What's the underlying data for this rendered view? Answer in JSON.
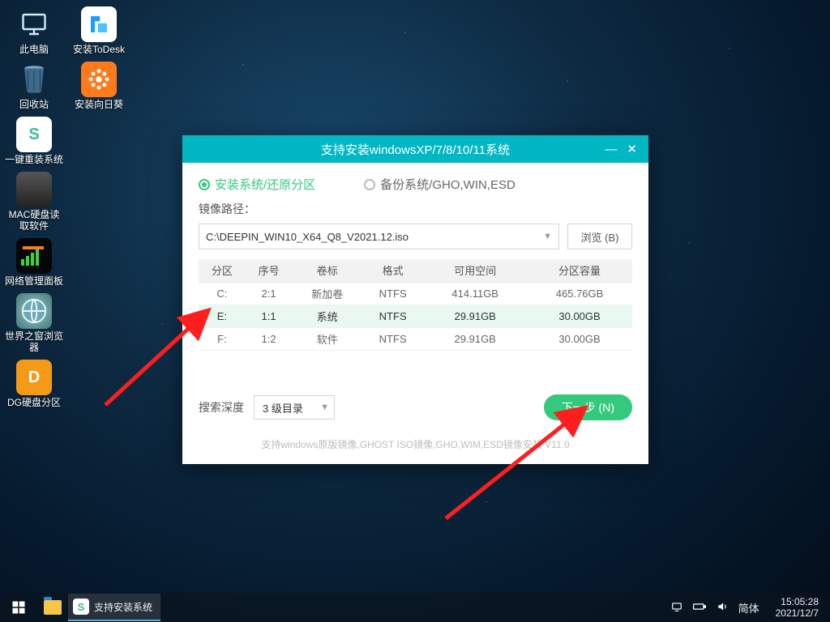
{
  "desktop": {
    "col1": [
      {
        "name": "pc",
        "label": "此电脑"
      },
      {
        "name": "bin",
        "label": "回收站"
      },
      {
        "name": "reinstall",
        "label": "一键重装系统"
      },
      {
        "name": "apple",
        "label": "MAC硬盘读\n取软件"
      },
      {
        "name": "netpanel",
        "label": "网络管理面板"
      },
      {
        "name": "browser",
        "label": "世界之窗浏览\n器"
      },
      {
        "name": "dg",
        "label": "DG硬盘分区"
      }
    ],
    "col2": [
      {
        "name": "todesk",
        "label": "安装ToDesk"
      },
      {
        "name": "sunflower",
        "label": "安装向日葵"
      }
    ]
  },
  "installer": {
    "title": "支持安装windowsXP/7/8/10/11系统",
    "tab_install": "安装系统/还原分区",
    "tab_backup": "备份系统/GHO,WIN,ESD",
    "path_label": "镜像路径：",
    "path_value": "C:\\DEEPIN_WIN10_X64_Q8_V2021.12.iso",
    "browse": "浏览 (B)",
    "columns": [
      "分区",
      "序号",
      "卷标",
      "格式",
      "可用空间",
      "分区容量"
    ],
    "rows": [
      {
        "part": "C:",
        "idx": "2:1",
        "label": "新加卷",
        "fs": "NTFS",
        "free": "414.11GB",
        "total": "465.76GB",
        "selected": false
      },
      {
        "part": "E:",
        "idx": "1:1",
        "label": "系统",
        "fs": "NTFS",
        "free": "29.91GB",
        "total": "30.00GB",
        "selected": true
      },
      {
        "part": "F:",
        "idx": "1:2",
        "label": "软件",
        "fs": "NTFS",
        "free": "29.91GB",
        "total": "30.00GB",
        "selected": false
      }
    ],
    "search_depth_label": "搜索深度",
    "search_depth_value": "3 级目录",
    "next": "下一步 (N)",
    "footer": "支持windows原版镜像,GHOST ISO镜像,GHO,WIM,ESD镜像安装 V11.0"
  },
  "taskbar": {
    "app_label": "支持安装系统",
    "ime": "简体",
    "time": "15:05:28",
    "date": "2021/12/7"
  }
}
